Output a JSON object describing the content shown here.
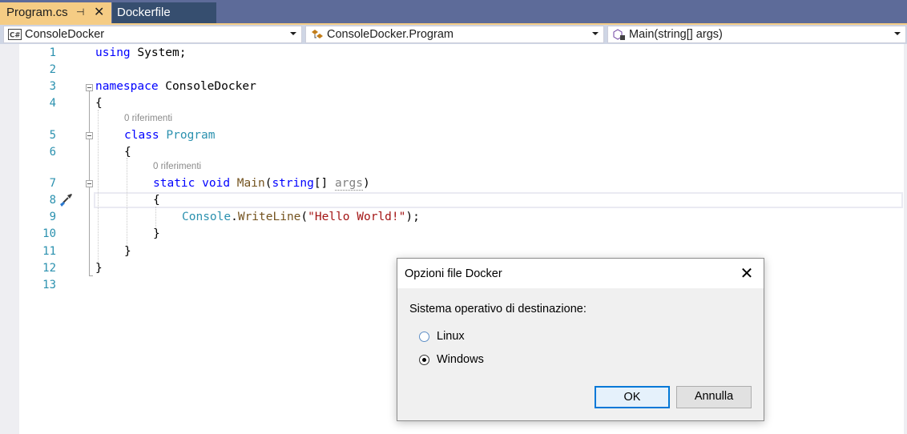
{
  "tabs": [
    {
      "label": "Program.cs",
      "active": true
    },
    {
      "label": "Dockerfile",
      "active": false
    }
  ],
  "tab_icons": {
    "pin": "pin-icon",
    "close": "close-icon"
  },
  "navbar": {
    "project": {
      "label": "ConsoleDocker",
      "icon": "csharp-project-icon"
    },
    "type": {
      "label": "ConsoleDocker.Program",
      "icon": "class-icon"
    },
    "member": {
      "label": "Main(string[] args)",
      "icon": "method-icon"
    }
  },
  "editor": {
    "line_numbers": [
      "1",
      "2",
      "3",
      "4",
      "5",
      "6",
      "7",
      "8",
      "9",
      "10",
      "11",
      "12",
      "13"
    ],
    "code": {
      "l1_kw": "using",
      "l1_rest": " System;",
      "l3_kw": "namespace",
      "l3_rest": " ConsoleDocker",
      "l4": "{",
      "lens_class": "0 riferimenti",
      "l5_kw": "class",
      "l5_type": "Program",
      "l6": "{",
      "lens_main": "0 riferimenti",
      "l7_kw1": "static",
      "l7_kw2": "void",
      "l7_method": "Main",
      "l7_p1": "(",
      "l7_kw3": "string",
      "l7_p2": "[] ",
      "l7_arg": "args",
      "l7_p3": ")",
      "l8": "{",
      "l9_type": "Console",
      "l9_dot": ".",
      "l9_method": "WriteLine",
      "l9_p1": "(",
      "l9_str": "\"Hello World!\"",
      "l9_p2": ");",
      "l10": "}",
      "l11": "}",
      "l12": "}"
    }
  },
  "dialog": {
    "title": "Opzioni file Docker",
    "prompt": "Sistema operativo di destinazione:",
    "options": [
      {
        "label": "Linux",
        "selected": false
      },
      {
        "label": "Windows",
        "selected": true
      }
    ],
    "ok_label": "OK",
    "cancel_label": "Annulla"
  },
  "colors": {
    "tab_active": "#f5cc84",
    "tab_strip": "#5d6b99",
    "keyword": "#0000ff",
    "type": "#2b91af",
    "string": "#a31515"
  }
}
